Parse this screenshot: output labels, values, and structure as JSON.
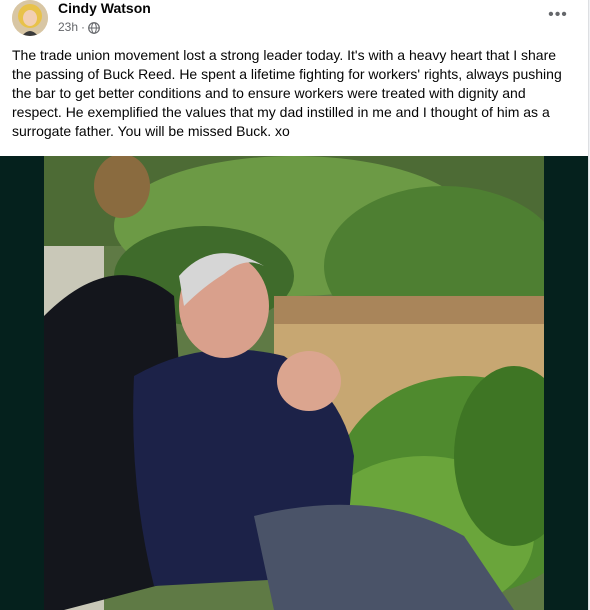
{
  "post": {
    "author_name": "Cindy Watson",
    "timestamp": "23h",
    "separator": "·",
    "audience_icon": "globe-icon",
    "more_icon": "more-options-icon",
    "more_label": "•••",
    "text": "The trade union movement lost a strong leader today. It's with a heavy heart that I share the passing of Buck Reed. He spent a lifetime fighting for workers' rights, always pushing the bar to get better conditions and to ensure workers were treated with dignity and respect. He exemplified the values that my dad instilled in me and  I thought of him as a surrogate father. You will be missed Buck. xo",
    "photo_icon": "post-photo"
  },
  "colors": {
    "author": "#050505",
    "meta": "#65676b",
    "media_background": "#05211d",
    "page_background": "#f0f2f5"
  }
}
